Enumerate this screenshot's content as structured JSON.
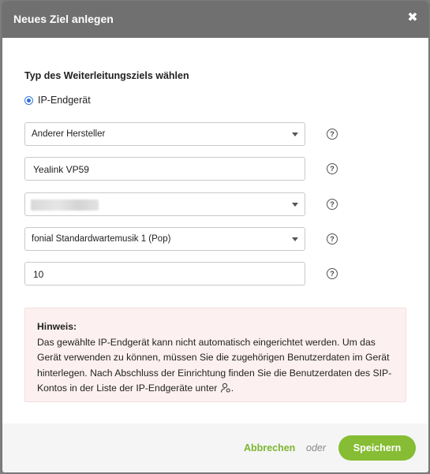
{
  "dialog": {
    "title": "Neues Ziel anlegen",
    "close_symbol": "✖"
  },
  "form": {
    "section_title": "Typ des Weiterleitungsziels wählen",
    "radio_label": "IP-Endgerät",
    "manufacturer_select": "Anderer Hersteller",
    "device_name_input": "Yealink VP59",
    "hold_music_select": "fonial Standardwartemusik 1 (Pop)",
    "number_input": "10",
    "help_symbol": "?"
  },
  "hint": {
    "title": "Hinweis:",
    "text": "Das gewählte IP-Endgerät kann nicht automatisch eingerichtet werden. Um das Gerät verwenden zu können, müssen Sie die zugehörigen Benutzerdaten im Gerät hinterlegen. Nach Abschluss der Einrichtung finden Sie die Benutzerdaten des SIP-Kontos in der Liste der IP-Endgeräte unter",
    "text_end": "."
  },
  "footer": {
    "cancel_label": "Abbrechen",
    "or_label": "oder",
    "save_label": "Speichern"
  },
  "colors": {
    "header_bg": "#707070",
    "accent_green": "#86bd34",
    "hint_bg": "#fdf0f0",
    "radio_blue": "#2a6fe0"
  }
}
